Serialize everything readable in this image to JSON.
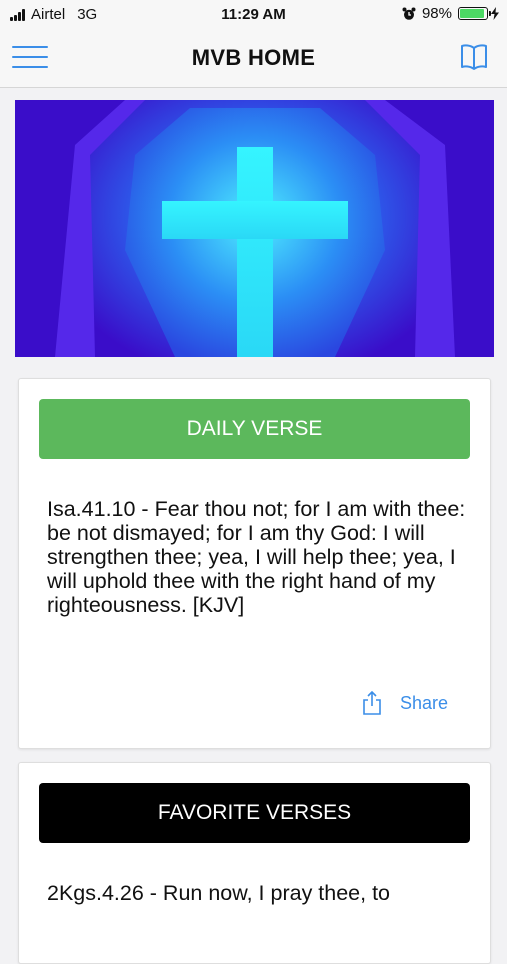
{
  "status_bar": {
    "carrier": "Airtel",
    "network": "3G",
    "time": "11:29 AM",
    "battery": "98%",
    "battery_level": 0.98,
    "icons": [
      "signal-icon",
      "alarm-icon",
      "battery-icon",
      "charging-bolt-icon"
    ]
  },
  "navbar": {
    "title": "MVB HOME",
    "icons": [
      "hamburger-menu-icon",
      "book-icon"
    ]
  },
  "banner": {
    "icon": "cross-icon",
    "colors": {
      "background": "#3a0dc9",
      "glow": "#2ff4ff"
    }
  },
  "daily_verse": {
    "button_label": "DAILY VERSE",
    "text": "Isa.41.10 - Fear thou not; for I am with thee: be not dismayed; for I am thy God: I will strengthen thee; yea, I will help thee; yea, I will uphold thee with the right hand of my righteousness. [KJV]",
    "share_label": "Share",
    "share_icon": "share-icon",
    "button_color": "#5cb85c"
  },
  "favorite_verses": {
    "button_label": "FAVORITE VERSES",
    "text": "2Kgs.4.26 - Run now, I pray thee, to",
    "button_color": "#000000"
  },
  "accent_color": "#3b8ee8"
}
